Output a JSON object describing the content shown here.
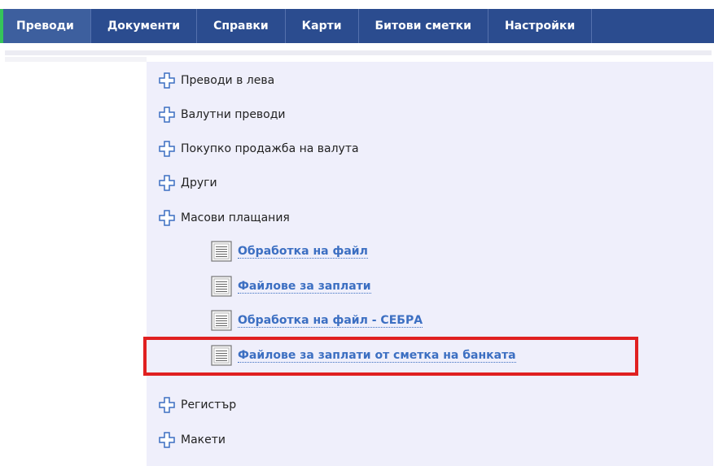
{
  "nav": {
    "tabs": [
      {
        "label": "Преводи",
        "active": true
      },
      {
        "label": "Документи",
        "active": false
      },
      {
        "label": "Справки",
        "active": false
      },
      {
        "label": "Карти",
        "active": false
      },
      {
        "label": "Битови сметки",
        "active": false
      },
      {
        "label": "Настройки",
        "active": false
      }
    ]
  },
  "menu": {
    "items": [
      {
        "label": "Преводи в лева",
        "icon": "plus-icon"
      },
      {
        "label": "Валутни преводи",
        "icon": "plus-icon"
      },
      {
        "label": "Покупко продажба на валута",
        "icon": "plus-icon"
      },
      {
        "label": "Други",
        "icon": "plus-icon"
      },
      {
        "label": "Масови плащания",
        "icon": "plus-icon"
      },
      {
        "label": "Регистър",
        "icon": "plus-icon"
      },
      {
        "label": "Макети",
        "icon": "plus-icon"
      }
    ],
    "subitems": [
      {
        "label": "Обработка на файл",
        "icon": "document-icon"
      },
      {
        "label": "Файлове за заплати",
        "icon": "document-icon"
      },
      {
        "label": "Обработка на файл - СЕБРА",
        "icon": "document-icon"
      },
      {
        "label": "Файлове за заплати от сметка на банката",
        "icon": "document-icon",
        "highlighted": true
      }
    ]
  },
  "colors": {
    "nav_bg": "#2b4c8f",
    "active_marker": "#35c45a",
    "link": "#3c6fc2",
    "content_bg": "#efeffb",
    "highlight": "#e02020"
  }
}
